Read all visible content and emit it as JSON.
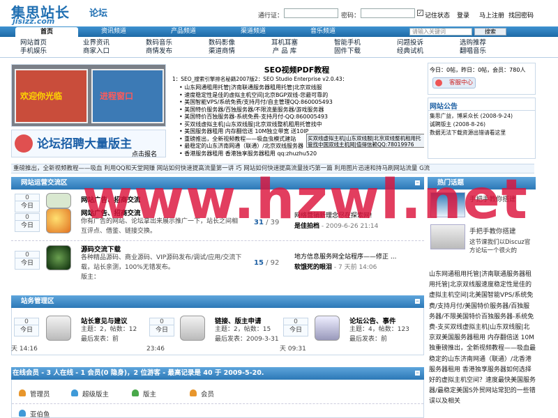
{
  "header": {
    "logo_main": "集思站长",
    "logo_small": "论坛",
    "logo_url": "jisizz.com",
    "passport_label": "通行证：",
    "password_label": "密码：",
    "remember_label": "记住状态",
    "login_label": "登录",
    "register_label": "马上注册",
    "forgot_label": "找回密码"
  },
  "nav": {
    "tabs": [
      "首页",
      "资讯频道",
      "产品频道",
      "渠道频道",
      "音乐频道"
    ],
    "search_placeholder": "请输入关键词",
    "search_button": "搜索"
  },
  "subnav": {
    "columns": [
      [
        "网站首页",
        "手机娱乐"
      ],
      [
        "业界资讯",
        "商家入口"
      ],
      [
        "数码音乐",
        "商情发布"
      ],
      [
        "数码影像",
        "渠道商情"
      ],
      [
        "耳机耳塞",
        "产 品 库"
      ],
      [
        "智能手机",
        "固件下载"
      ],
      [
        "问题投诉",
        "经典试机"
      ],
      [
        "选购推荐",
        "翻唱音乐"
      ]
    ]
  },
  "promo": {
    "title": "SEO视频PDF教程",
    "subtitle": "1：SEO_搜索引擎排名秘籍2007版2：SEO Studio Enterprise v2.0.43：",
    "lines": [
      "山东网通租用托管|济南联通服务器租用托管|北京双线服",
      "速度稳定性是佳的虚拟主机空间|北京BGP双线-您最可靠的",
      "美国智能VPS/系统免费/支持月付/自主管理QQ:860005493",
      "美国特价服务器/百独服务器/不限流量服务器/游戏服务器",
      "美国特价百独服务器-系统免费-支持月付-QQ:860005493",
      "买双线虚拟主机|山东双线服|北京双线整机租用托管找中",
      "美国服务器租用 内存翻倍送 10M独立带宽 送10IP",
      "重磅推出，全新视频教程——吸血虫模式建站",
      "最稳定的山东济南网通（联通）/北京双线服务器",
      "香港服务器租用 香港独享服务器租用 qq:zhuzhu520"
    ],
    "tooltip": "买双线虚拟主机|山东双线服|北京双线整机租用托管找中国双线主机网|值得信赖QQ:78019976",
    "recruit": "论坛招聘大量版主",
    "recruit_sub": "点击报名",
    "img_text_1": "欢迎你光临",
    "img_text_2": "进程窗口"
  },
  "stats": {
    "text": "今日：0帖，昨日：0帖，会员：780人",
    "service": "客服中心"
  },
  "notice": {
    "title": "网站公告",
    "items": [
      "集思广益，博采众长 (2008-9-24)",
      "诚聘版主 (2008-8-26)",
      "数据无法下载资源出错请看这里"
    ]
  },
  "ticker": "重磅推出，全新视频教程——吸血  利用QQ和天堂网赚  网站如何快速提高流量第一讲  巧  网站如何快速提高流量技巧第一篇  利用图片迅速和持马刷网站流量  G流",
  "sections": [
    {
      "title": "网站运营交流区",
      "forums": [
        {
          "name": "网站广告、招商交流",
          "desc": "你有广告的网站、论坛拿出来展示推广一下，站长之间相互评点、借鉴、链接交换。",
          "count_top": "0",
          "count_bottom": "今日",
          "topics": "31",
          "posts": "39",
          "last_title": "网络营销新理念尽在探索网!",
          "last_by": "是佳拍档",
          "last_time": "- 2009-6-26 21:14"
        },
        {
          "name": "源码交流下载",
          "desc": "各种精品源码、商业源码、VIP源码发布/调试/应用/交流下载，站长亲测，100%无错发布。",
          "admin": "版主：",
          "count_top": "0",
          "count_bottom": "今日",
          "topics": "15",
          "posts": "92",
          "last_title": "地方信息服务网全站程序——修正 ...",
          "last_by": "软饿死的眼泪",
          "last_time": "- 7 天前 14:06"
        }
      ],
      "top_forum": {
        "name": "网站广告、招商交流",
        "count_top": "0",
        "count_bottom": "今日"
      }
    },
    {
      "title": "站务管理区",
      "forums": [
        {
          "name": "站长意见与建议",
          "stats": "主题：2，帖数：12",
          "last": "最后发表：前",
          "time": "天 14:16",
          "count_top": "0",
          "count_bottom": "今日"
        },
        {
          "name": "链接、版主申请",
          "stats": "主题：2，帖数：15",
          "last": "最后发表：2009-3-31",
          "time": "23:46",
          "count_top": "0",
          "count_bottom": "今日"
        },
        {
          "name": "论坛公告、事件",
          "stats": "主题：4，帖数：123",
          "last": "最后发表：前",
          "time": "天 09:31",
          "count_top": "0",
          "count_bottom": "今日"
        }
      ]
    }
  ],
  "online": {
    "title": "在线会员 - 3 人在线 - 1 会员(0 隐身)，2 位游客 - 最高记录是 40 于 2009-5-20.",
    "roles": [
      "管理员",
      "超级版主",
      "版主",
      "会员"
    ],
    "next": "亚伯鱼"
  },
  "hot": {
    "title": "热门话题",
    "items": [
      "手把手教你搭建",
      "手把手教你搭建",
      "这节课我们以Discuz官方论坛一个很火的"
    ],
    "text": "山东网通租用托管|济南联通服务器租用托管|北京双线服速度稳定性是佳的虚拟主机空间|北美国智能VPS/系统免费/支持月付/美国特价服务器/百独服务器/不限美国特价百独服务器-系统免费-支买双线虚拟主机|山东双线服|北京双美国服务器租用 内存翻倍送 10M独重磅推出，全新视频教程——吸血最稳定的山东济南网通（联通）/北香港服务器租用 香港独享服务器如何选择好的虚拟主机空间？速度最快美国服务器/最稳定美国S外贸网站常犯的一些错误以及相关"
  },
  "watermark": "www.hzwl.net",
  "colors": {
    "nav_blue": "#2c78b6",
    "link_blue": "#1c5fa3",
    "watermark": "#dc143c"
  }
}
